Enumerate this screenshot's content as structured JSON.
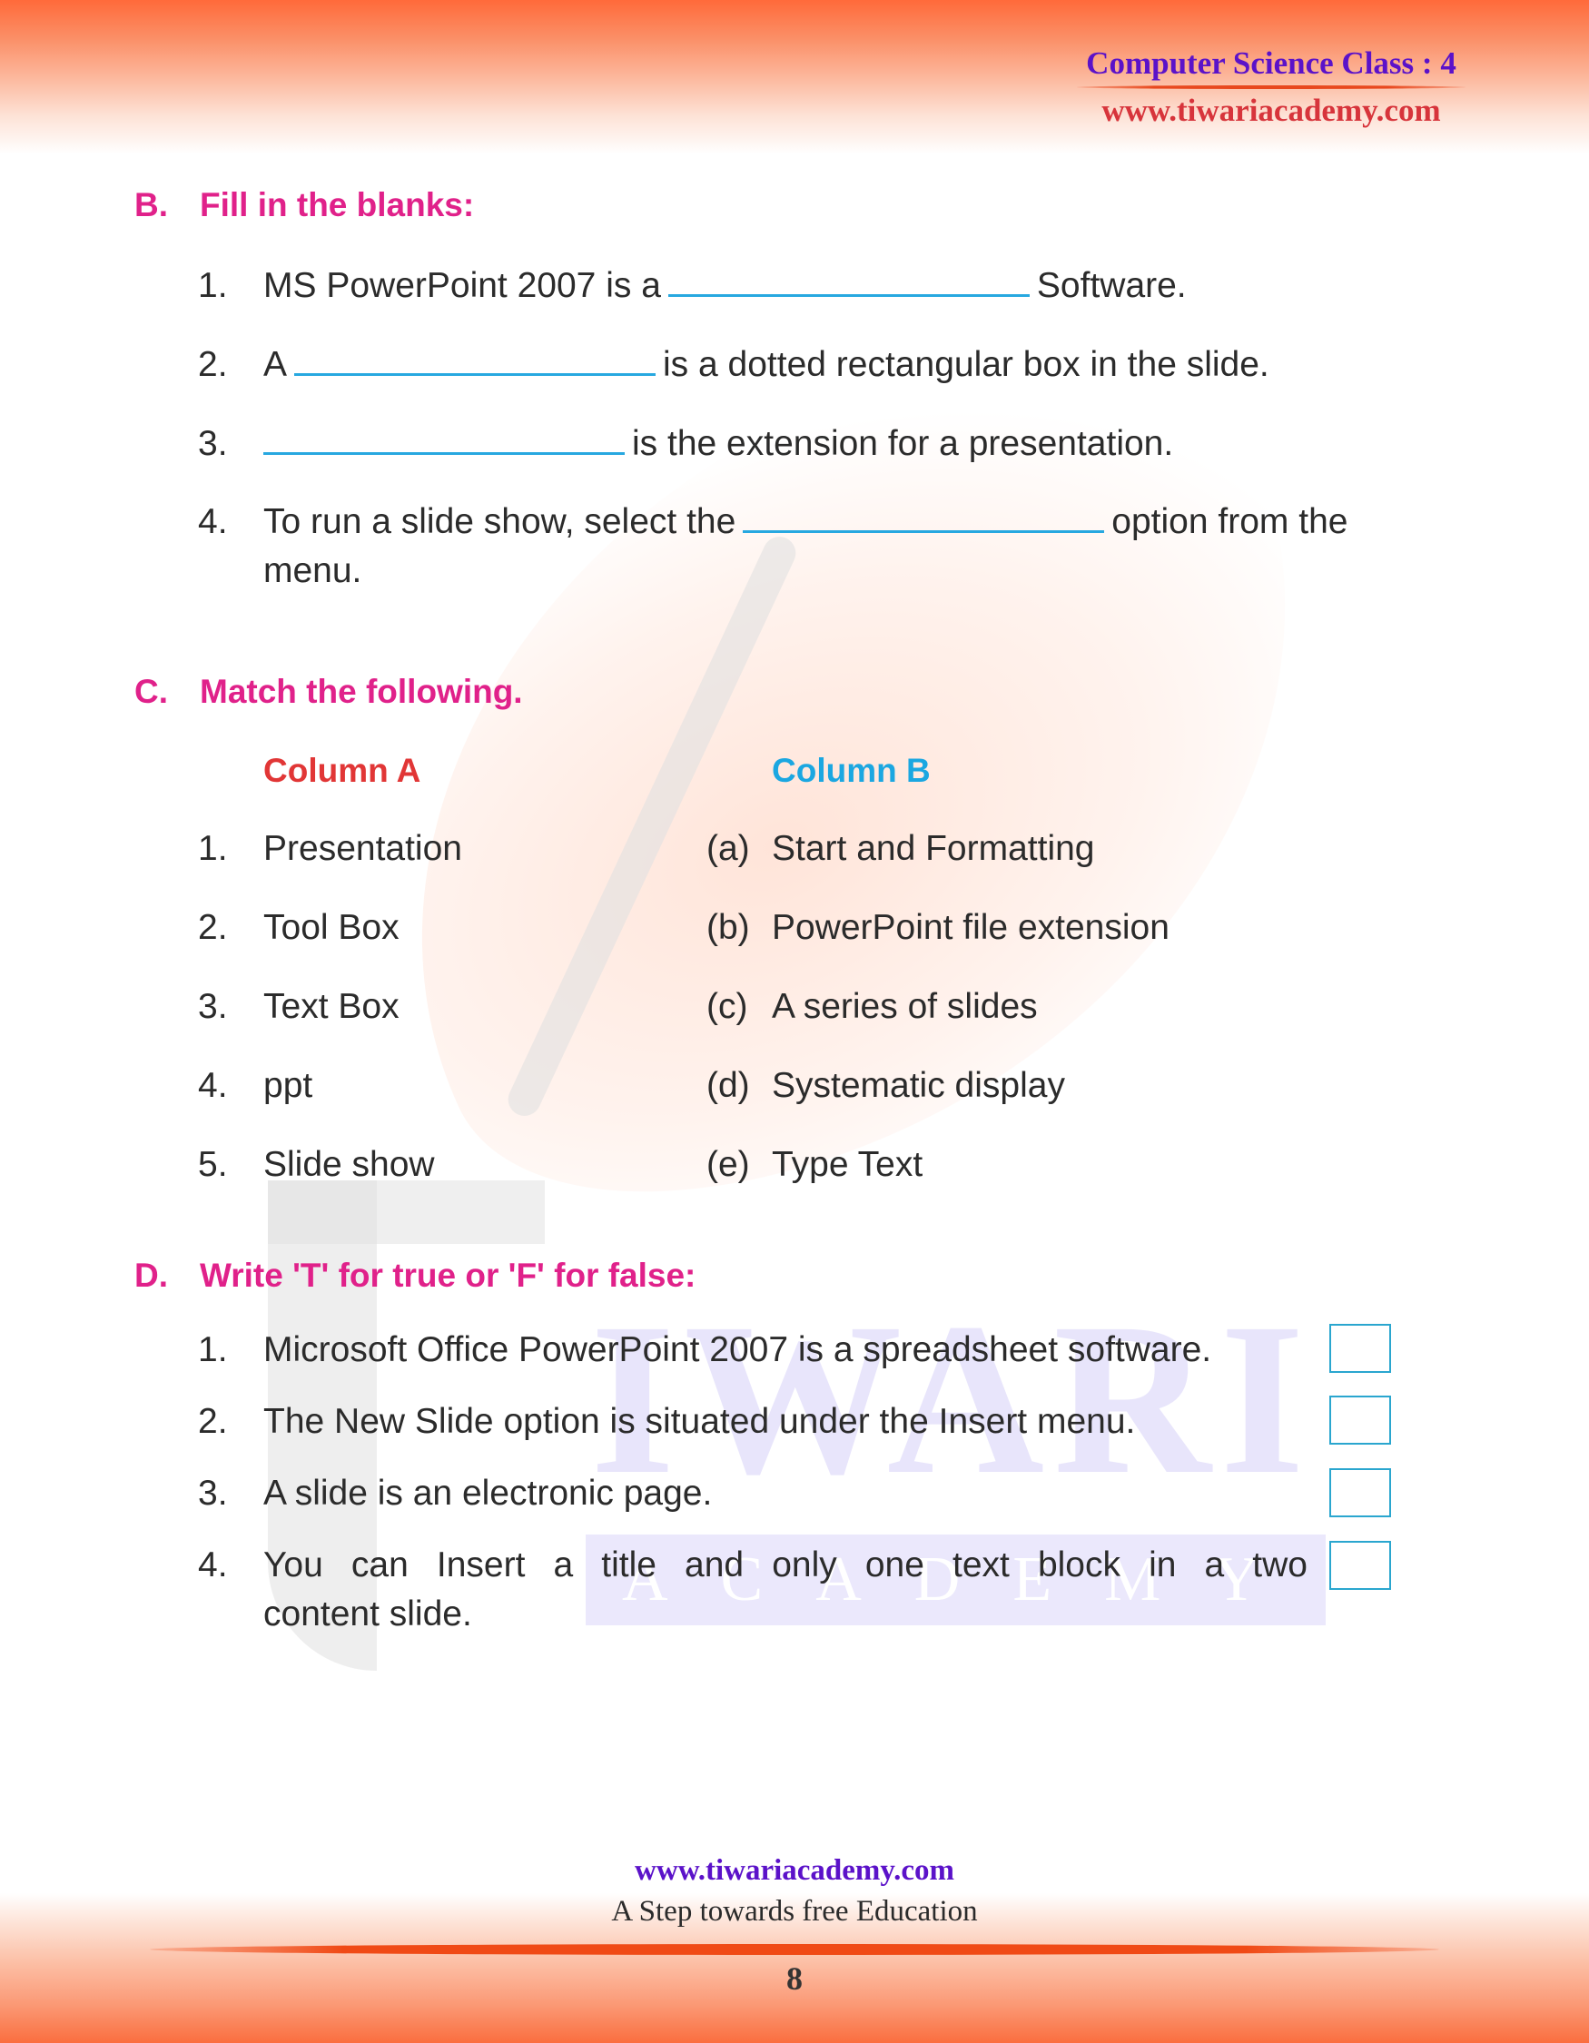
{
  "header": {
    "title": "Computer Science Class : 4",
    "url": "www.tiwariacademy.com"
  },
  "watermark": {
    "big": "IWARI",
    "small": "ACADEMY"
  },
  "section_b": {
    "letter": "B.",
    "title": "Fill in the blanks:",
    "items": [
      {
        "num": "1.",
        "before": "MS PowerPoint 2007 is a",
        "after": "Software."
      },
      {
        "num": "2.",
        "before": "A",
        "after": "is a dotted rectangular box in the slide."
      },
      {
        "num": "3.",
        "before": "",
        "after": "is the extension for a presentation."
      },
      {
        "num": "4.",
        "before": "To run a slide show, select the",
        "after": "option from the",
        "continuation": "menu."
      }
    ]
  },
  "section_c": {
    "letter": "C.",
    "title": "Match the following.",
    "column_a_label": "Column A",
    "column_b_label": "Column B",
    "column_a": [
      {
        "num": "1.",
        "text": "Presentation"
      },
      {
        "num": "2.",
        "text": "Tool Box"
      },
      {
        "num": "3.",
        "text": "Text Box"
      },
      {
        "num": "4.",
        "text": "ppt"
      },
      {
        "num": "5.",
        "text": "Slide show"
      }
    ],
    "column_b": [
      {
        "tag": "(a)",
        "text": "Start and Formatting"
      },
      {
        "tag": "(b)",
        "text": "PowerPoint file extension"
      },
      {
        "tag": "(c)",
        "text": "A series of slides"
      },
      {
        "tag": "(d)",
        "text": "Systematic display"
      },
      {
        "tag": "(e)",
        "text": "Type Text"
      }
    ]
  },
  "section_d": {
    "letter": "D.",
    "title": "Write 'T' for true or 'F' for false:",
    "items": [
      {
        "num": "1.",
        "text": "Microsoft Office PowerPoint 2007 is a spreadsheet software.",
        "answer": ""
      },
      {
        "num": "2.",
        "text": "The New Slide option is situated under the Insert menu.",
        "answer": ""
      },
      {
        "num": "3.",
        "text": "A slide is an electronic page.",
        "answer": ""
      },
      {
        "num": "4.",
        "text": "You can Insert a title and only one text block in a two",
        "continuation": "content slide.",
        "answer": ""
      }
    ]
  },
  "footer": {
    "url": "www.tiwariacademy.com",
    "tagline": "A Step towards free Education",
    "page_number": "8"
  },
  "colors": {
    "heading": "#e0218a",
    "column_a": "#e13636",
    "column_b": "#1ba7e1",
    "blank_line": "#27a8e0",
    "brand_purple": "#5b12c9",
    "brand_red": "#d7343b",
    "band_orange": "#ff6a3a"
  }
}
